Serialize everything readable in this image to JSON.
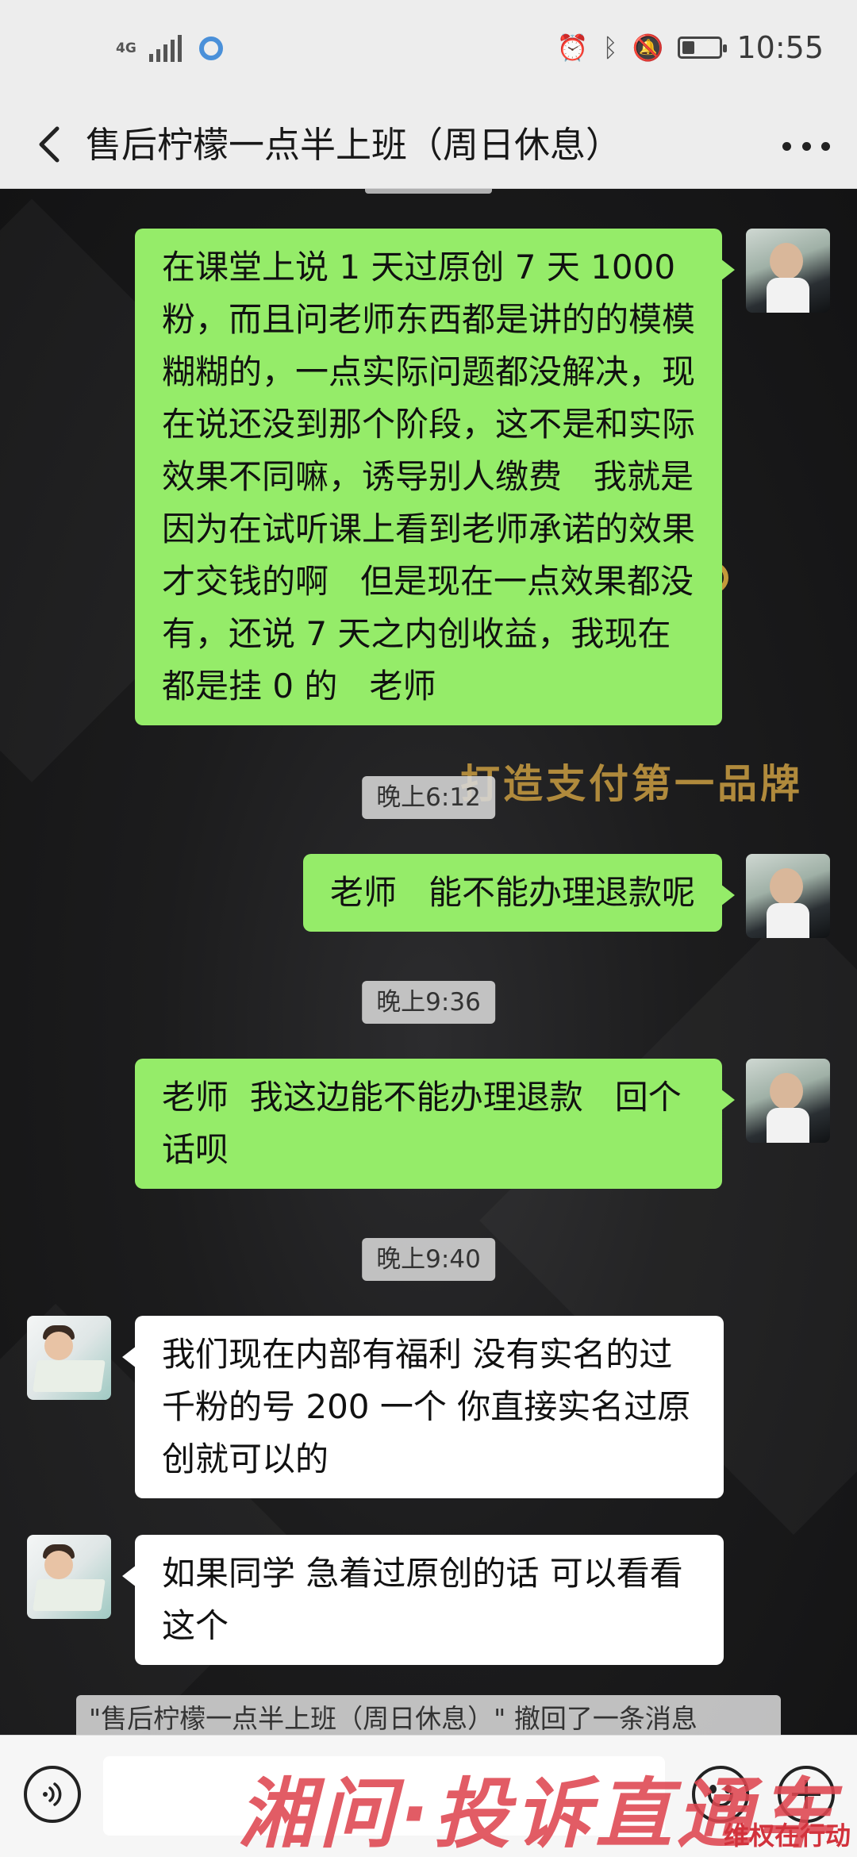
{
  "status_bar": {
    "network": "4G",
    "time": "10:55",
    "battery_level": 0.35,
    "icons": [
      "signal-icon",
      "app-notification-icon",
      "alarm-icon",
      "bluetooth-icon",
      "mute-icon",
      "battery-icon"
    ]
  },
  "nav": {
    "title": "售后柠檬一点半上班（周日休息）",
    "back_icon": "chevron-left-icon",
    "more_icon": "more-dots-icon"
  },
  "background": {
    "text": "打造支付第一品牌"
  },
  "messages": [
    {
      "sender": "me",
      "text": "在课堂上说 1 天过原创 7 天 1000 粉，而且问老师东西都是讲的的模模糊糊的，一点实际问题都没解决，现在说还没到那个阶段，这不是和实际效果不同嘛，诱导别人缴费   我就是因为在试听课上看到老师承诺的效果才交钱的啊   但是现在一点效果都没有，还说 7 天之内创收益，我现在都是挂 0 的   老师"
    },
    {
      "time": "晚上6:12"
    },
    {
      "sender": "me",
      "text": "老师   能不能办理退款呢"
    },
    {
      "time": "晚上9:36"
    },
    {
      "sender": "me",
      "text": "老师  我这边能不能办理退款   回个话呗"
    },
    {
      "time": "晚上9:40"
    },
    {
      "sender": "other",
      "text": "我们现在内部有福利 没有实名的过千粉的号 200 一个 你直接实名过原创就可以的"
    },
    {
      "sender": "other",
      "text": "如果同学 急着过原创的话 可以看看这个"
    }
  ],
  "system_message": "\"售后柠檬一点半上班（周日休息）\" 撤回了一条消息",
  "input_bar": {
    "voice_icon": "voice-icon",
    "emoji_icon": "emoji-icon",
    "plus_icon": "plus-icon",
    "text_value": ""
  },
  "watermark": {
    "main": "湘问·投诉直通车",
    "corner": "维权在行动"
  }
}
